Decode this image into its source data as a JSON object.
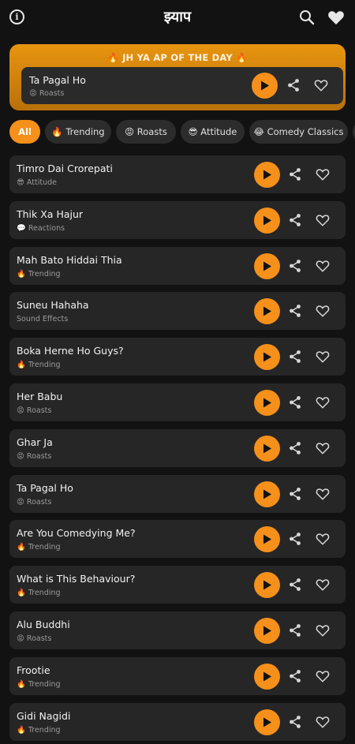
{
  "header": {
    "title": "झ्याप",
    "info_icon": "info-icon",
    "search_icon": "search-icon",
    "favorites_icon": "heart-icon",
    "info_glyph": "i"
  },
  "featured": {
    "heading": "🔥 JH YA AP OF THE DAY 🔥",
    "sound": {
      "name": "Ta Pagal Ho",
      "category": "😡 Roasts"
    }
  },
  "chips": [
    {
      "label": "All",
      "active": true
    },
    {
      "label": "🔥 Trending",
      "active": false
    },
    {
      "label": "😡 Roasts",
      "active": false
    },
    {
      "label": "😎 Attitude",
      "active": false
    },
    {
      "label": "😂 Comedy Classics",
      "active": false
    }
  ],
  "sounds": [
    {
      "name": "Timro Dai Crorepati",
      "category": "😎 Attitude"
    },
    {
      "name": "Thik Xa Hajur",
      "category": "💬 Reactions"
    },
    {
      "name": "Mah Bato Hiddai Thia",
      "category": "🔥 Trending"
    },
    {
      "name": "Suneu Hahaha",
      "category": "Sound Effects"
    },
    {
      "name": "Boka Herne Ho Guys?",
      "category": "🔥 Trending"
    },
    {
      "name": "Her Babu",
      "category": "😡 Roasts"
    },
    {
      "name": "Ghar Ja",
      "category": "😡 Roasts"
    },
    {
      "name": "Ta Pagal Ho",
      "category": "😡 Roasts"
    },
    {
      "name": "Are You Comedying Me?",
      "category": "🔥 Trending"
    },
    {
      "name": "What is This Behaviour?",
      "category": "🔥 Trending"
    },
    {
      "name": "Alu Buddhi",
      "category": "😡 Roasts"
    },
    {
      "name": "Frootie",
      "category": "🔥 Trending"
    },
    {
      "name": "Gidi Nagidi",
      "category": "🔥 Trending"
    }
  ],
  "colors": {
    "accent": "#f5901a",
    "background": "#121212",
    "card": "#262626",
    "featured_gradient_top": "#e8950f",
    "featured_gradient_bottom": "#b8700a"
  }
}
